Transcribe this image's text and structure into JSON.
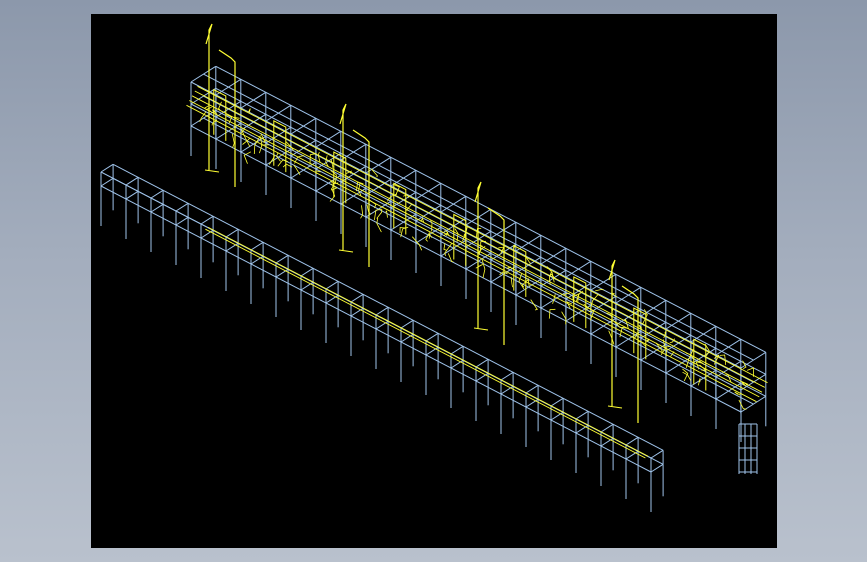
{
  "viewport": {
    "label": "",
    "background": "#000000"
  },
  "colors": {
    "frame": "#9fc3ea",
    "piping": "#ffff33",
    "desktop": "#a3adbd"
  },
  "model": {
    "type": "wireframe-3d",
    "description_visible": false,
    "structure_count": 2,
    "riser_count": 4
  }
}
